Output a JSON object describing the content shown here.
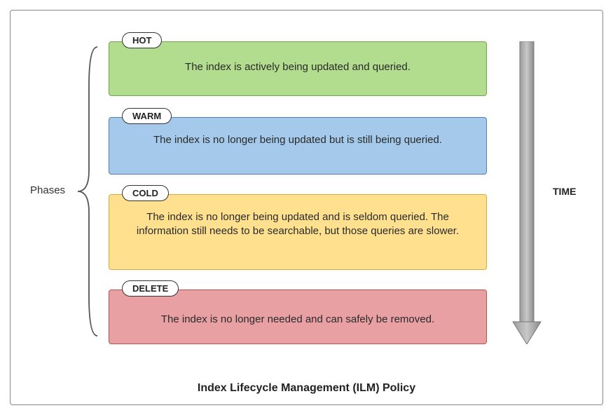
{
  "title": "Index Lifecycle Management (ILM) Policy",
  "phases_group_label": "Phases",
  "time_label": "TIME",
  "phases": [
    {
      "name": "HOT",
      "description": "The index is actively being updated and queried."
    },
    {
      "name": "WARM",
      "description": "The index is no longer being updated but is still being queried."
    },
    {
      "name": "COLD",
      "description": "The index is no longer being updated and is seldom queried. The information still needs to be searchable, but those queries are slower."
    },
    {
      "name": "DELETE",
      "description": "The index is no longer needed and can safely be removed."
    }
  ]
}
